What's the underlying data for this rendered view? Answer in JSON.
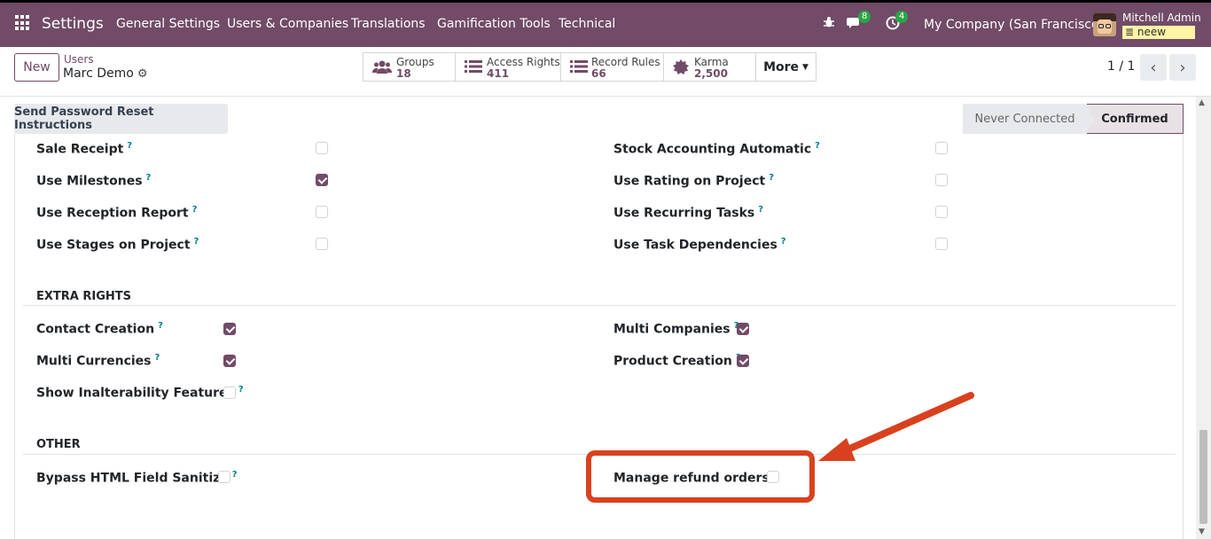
{
  "navbar": {
    "app_name": "Settings",
    "menus": [
      "General Settings",
      "Users & Companies",
      "Translations",
      "Gamification Tools",
      "Technical"
    ],
    "messages_count": "8",
    "activities_count": "4",
    "company": "My Company (San Francisco)",
    "user_name": "Mitchell Admin",
    "db_name": "neew",
    "icons": [
      "apps-grid-icon",
      "bug-icon",
      "chat-icon",
      "clock-icon",
      "avatar"
    ],
    "color": "#714b67"
  },
  "control": {
    "new_label": "New",
    "breadcrumb_parent": "Users",
    "breadcrumb_current": "Marc Demo",
    "smart_buttons": [
      {
        "label": "Groups",
        "value": "18",
        "icon": "users-icon"
      },
      {
        "label": "Access Rights",
        "value": "411",
        "icon": "list-icon"
      },
      {
        "label": "Record Rules",
        "value": "66",
        "icon": "list-icon"
      },
      {
        "label": "Karma",
        "value": "2,500",
        "icon": "karma-badge-icon"
      }
    ],
    "more_label": "More",
    "pager_value": "1 / 1"
  },
  "status": {
    "reset_label": "Send Password Reset Instructions",
    "stages": [
      "Never Connected",
      "Confirmed"
    ],
    "active_stage": "Confirmed"
  },
  "technical": {
    "left": [
      {
        "label": "Sale Receipt",
        "checked": false
      },
      {
        "label": "Use Milestones",
        "checked": true
      },
      {
        "label": "Use Reception Report",
        "checked": false
      },
      {
        "label": "Use Stages on Project",
        "checked": false
      }
    ],
    "right": [
      {
        "label": "Stock Accounting Automatic",
        "checked": false
      },
      {
        "label": "Use Rating on Project",
        "checked": false
      },
      {
        "label": "Use Recurring Tasks",
        "checked": false
      },
      {
        "label": "Use Task Dependencies",
        "checked": false
      }
    ]
  },
  "extra_rights": {
    "title": "EXTRA RIGHTS",
    "left": [
      {
        "label": "Contact Creation",
        "checked": true
      },
      {
        "label": "Multi Currencies",
        "checked": true
      },
      {
        "label": "Show Inalterability Features",
        "checked": false
      }
    ],
    "right": [
      {
        "label": "Multi Companies",
        "checked": true
      },
      {
        "label": "Product Creation",
        "checked": true
      }
    ]
  },
  "other": {
    "title": "OTHER",
    "left": [
      {
        "label": "Bypass HTML Field Sanitize",
        "checked": false
      }
    ],
    "right": [
      {
        "label": "Manage refund orders",
        "checked": false
      }
    ]
  },
  "help_mark": "?",
  "highlight_color": "#d9411e"
}
